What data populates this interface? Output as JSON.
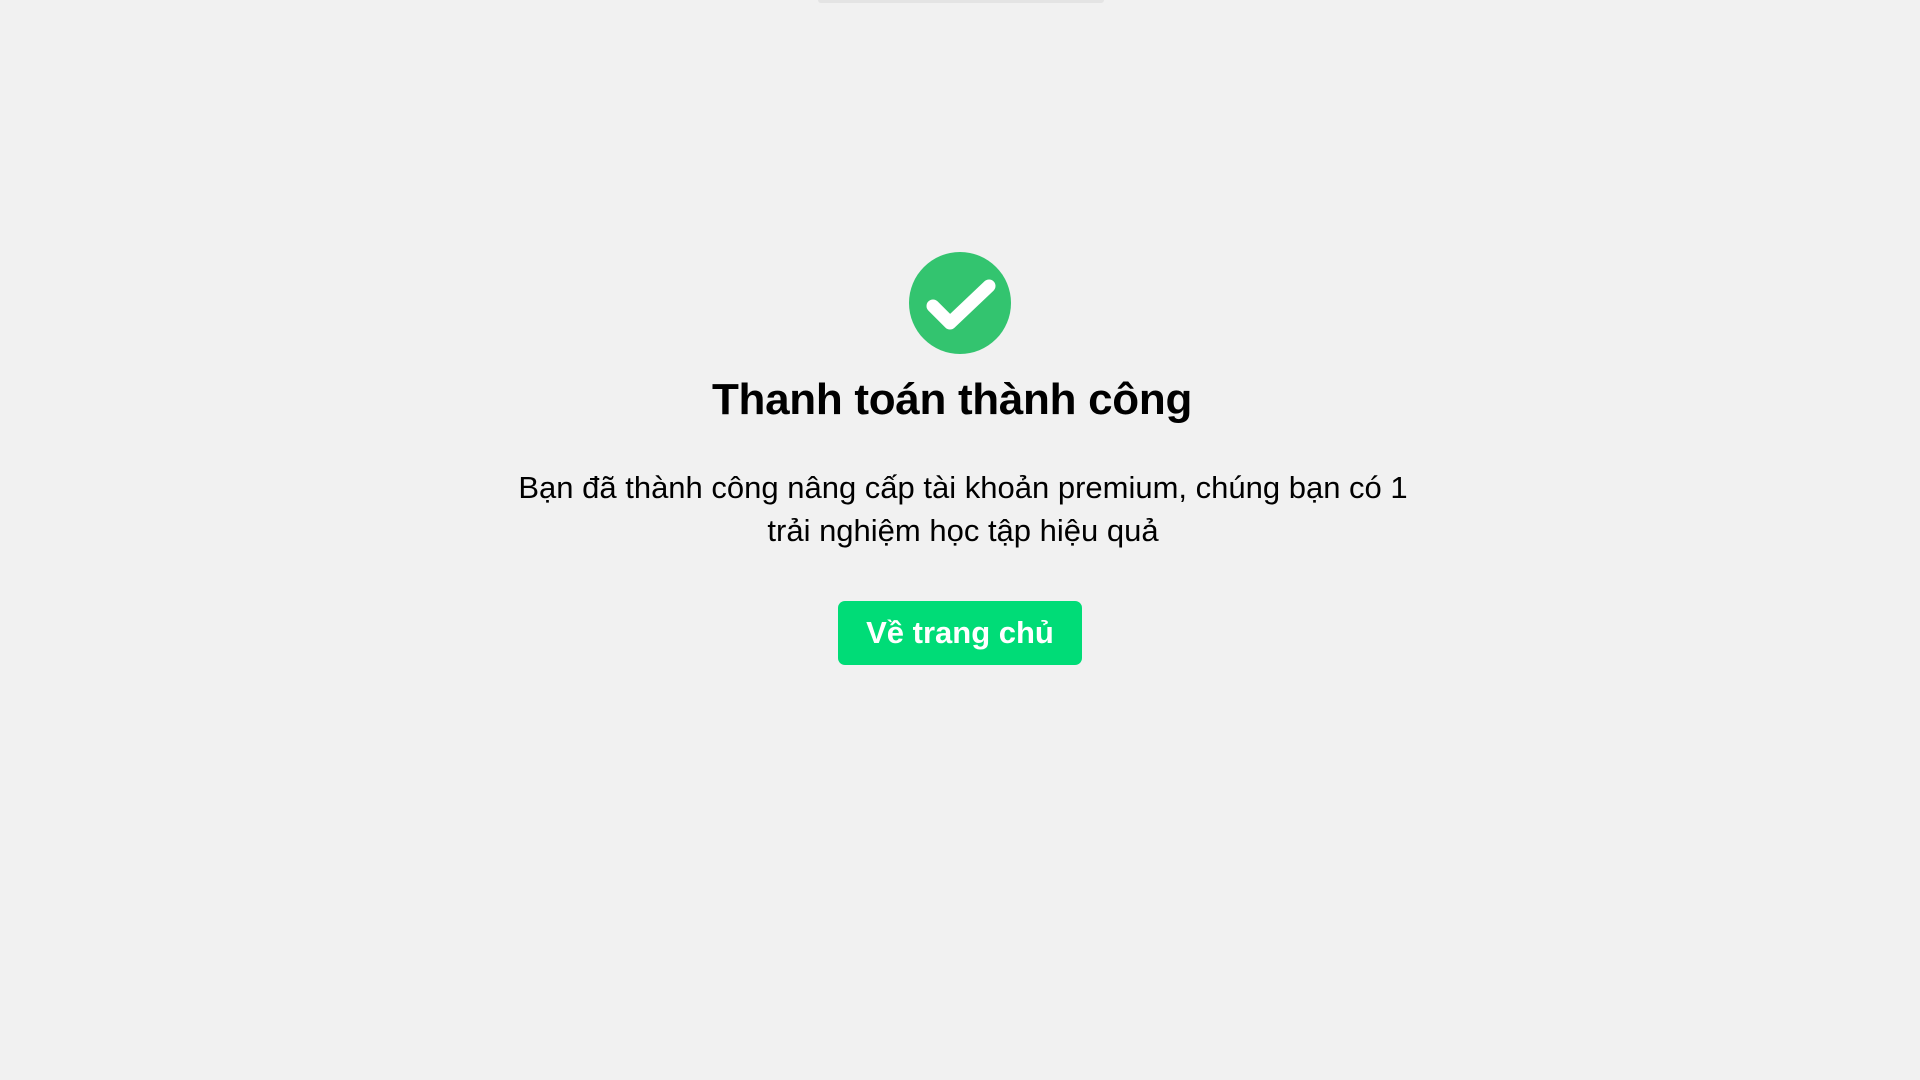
{
  "theme": {
    "background": "#f1f1f1",
    "success_icon_color": "#33c46f",
    "button_color": "#00dc77",
    "button_text_color": "#ffffff"
  },
  "icon": {
    "name": "check-circle-icon"
  },
  "title": "Thanh toán thành công",
  "message": "Bạn đã thành công nâng cấp tài khoản premium, chúng bạn có 1 trải nghiệm học tập hiệu quả",
  "home_button": {
    "label": "Về trang chủ"
  }
}
